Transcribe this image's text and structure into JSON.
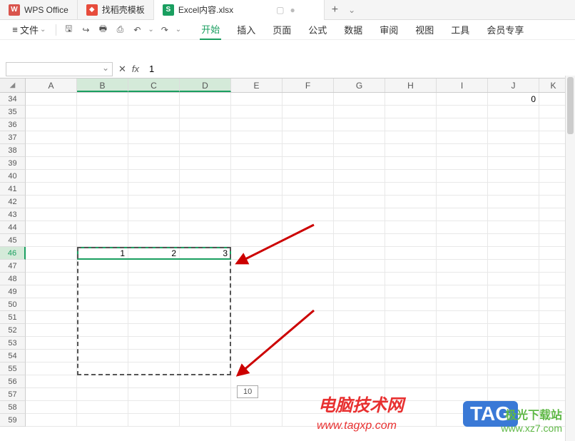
{
  "tabs": [
    {
      "icon": "W",
      "label": "WPS Office",
      "icon_class": "wps"
    },
    {
      "icon": "⬥",
      "label": "找稻壳模板",
      "icon_class": "dao"
    },
    {
      "icon": "S",
      "label": "Excel内容.xlsx",
      "icon_class": "excel",
      "active": true
    }
  ],
  "tab_add": "+",
  "file_menu": {
    "hamburger": "≡",
    "label": "文件"
  },
  "toolbar_icons": [
    "save",
    "print-preview",
    "print",
    "export",
    "undo",
    "redo"
  ],
  "ribbon": {
    "tabs": [
      "开始",
      "插入",
      "页面",
      "公式",
      "数据",
      "审阅",
      "视图",
      "工具",
      "会员专享"
    ],
    "active": "开始"
  },
  "formula_bar": {
    "name_box": "",
    "fx_label": "fx",
    "value": "1"
  },
  "columns": [
    "A",
    "B",
    "C",
    "D",
    "E",
    "F",
    "G",
    "H",
    "I",
    "J",
    "K"
  ],
  "selected_cols": [
    "B",
    "C",
    "D"
  ],
  "rows_start": 34,
  "rows_end": 59,
  "selected_row": 46,
  "cells": {
    "B46": "1",
    "C46": "2",
    "D46": "3",
    "J34": "0"
  },
  "fill_tooltip": "10",
  "watermark": {
    "text_cn": "电脑技术网",
    "url": "www.tagxp.com",
    "tag": "TAG",
    "xz_cn": "极光下载站",
    "xz_url": "www.xz7.com"
  }
}
